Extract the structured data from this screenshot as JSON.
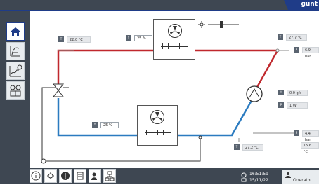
{
  "header": {
    "brand_label": "gunt"
  },
  "sidebar": {
    "items": [
      {
        "name": "home",
        "icon": "home-icon",
        "active": true
      },
      {
        "name": "diagram",
        "icon": "diagram-icon",
        "active": false
      },
      {
        "name": "trend",
        "icon": "trend-icon",
        "active": false
      },
      {
        "name": "glasses",
        "icon": "glasses-icon",
        "active": false
      }
    ]
  },
  "process": {
    "t1": {
      "label": "T",
      "sub": "1",
      "value": "22.0 °C"
    },
    "t2": {
      "label": "T",
      "sub": "2",
      "value": "27.7 °C"
    },
    "p1": {
      "label": "P",
      "sub": "1",
      "value": "6.9 bar"
    },
    "m_dot": {
      "label": "ṁ",
      "value": "0.0 g/s"
    },
    "power": {
      "label": "P",
      "sub": "el",
      "value": "1 W"
    },
    "y1": {
      "label": "Y",
      "sub": "1",
      "value": "25 %"
    },
    "y2": {
      "label": "Y",
      "sub": "2",
      "value": "25 %"
    },
    "p2": {
      "label": "P",
      "sub": "2",
      "value": "4.4 bar"
    },
    "t3": {
      "label": "T",
      "sub": "3",
      "value": "15.6 °C"
    },
    "t4": {
      "label": "T",
      "sub": "4",
      "value": "27.2 °C"
    }
  },
  "status": {
    "time": "16:51:59",
    "date": "15/11/22",
    "user": "Operator"
  },
  "colors": {
    "hot_line": "#c0282d",
    "cold_line": "#2b7bc0",
    "ui_dark": "#3e4752",
    "brand": "#1f3c88"
  }
}
